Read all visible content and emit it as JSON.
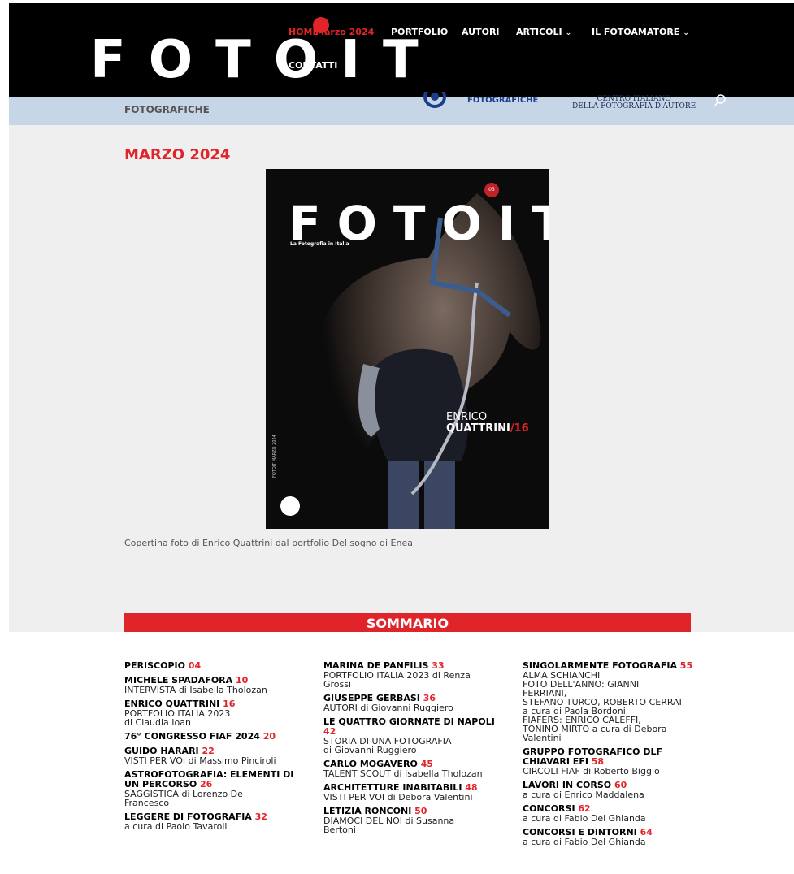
{
  "brand": {
    "logo_text": "FOTOIT"
  },
  "nav": {
    "items": [
      {
        "label": "HOME",
        "overlay": "Marzo 2024",
        "has_dropdown": false
      },
      {
        "label": "PORTFOLIO",
        "has_dropdown": false
      },
      {
        "label": "AUTORI",
        "has_dropdown": false
      },
      {
        "label": "ARTICOLI",
        "has_dropdown": true
      },
      {
        "label": "IL FOTOAMATORE",
        "has_dropdown": true
      },
      {
        "label": "CONTATTI",
        "has_dropdown": false
      }
    ]
  },
  "subheader": {
    "left_text": "FOTOGRAFICHE",
    "fiaf_text": "FOTOGRAFICHE",
    "cifa_line1": "CENTRO ITALIANO",
    "cifa_line2": "DELLA FOTOGRAFIA D'AUTORE"
  },
  "article": {
    "title": "MARZO 2024",
    "cover": {
      "logo": "FOTOIT",
      "subtitle": "La Fotografia in Italia",
      "issue": "03",
      "author_first": "ENRICO",
      "author_last": "QUATTRINI",
      "page_ref": "/16",
      "spine": "FOTOIT MARZO 2024"
    },
    "caption": "Copertina foto di Enrico Quattrini dal portfolio Del sogno di Enea"
  },
  "summary": {
    "heading": "SOMMARIO",
    "columns": [
      [
        {
          "title": "PERISCOPIO",
          "page": "04",
          "lines": []
        },
        {
          "title": "MICHELE SPADAFORA",
          "page": "10",
          "lines": [
            "INTERVISTA di Isabella Tholozan"
          ]
        },
        {
          "title": "ENRICO QUATTRINI",
          "page": "16",
          "lines": [
            "PORTFOLIO ITALIA 2023",
            "di Claudia Ioan"
          ]
        },
        {
          "title": "76° CONGRESSO FIAF 2024",
          "page": "20",
          "lines": []
        },
        {
          "title": "GUIDO HARARI",
          "page": "22",
          "lines": [
            "VISTI PER VOI di Massimo Pinciroli"
          ]
        },
        {
          "title": "ASTROFOTOGRAFIA: ELEMENTI DI UN PERCORSO",
          "page": "26",
          "lines": [
            "SAGGISTICA di Lorenzo De",
            "Francesco"
          ]
        },
        {
          "title": "LEGGERE DI FOTOGRAFIA",
          "page": "32",
          "lines": [
            "a cura di Paolo Tavaroli"
          ]
        }
      ],
      [
        {
          "title": "MARINA DE PANFILIS",
          "page": "33",
          "lines": [
            "PORTFOLIO ITALIA 2023 di Renza",
            "Grossi"
          ]
        },
        {
          "title": "GIUSEPPE GERBASI",
          "page": "36",
          "lines": [
            "AUTORI di Giovanni Ruggiero"
          ]
        },
        {
          "title": "LE QUATTRO GIORNATE DI NAPOLI",
          "page": "42",
          "lines": [
            "STORIA DI UNA FOTOGRAFIA",
            "di Giovanni Ruggiero"
          ]
        },
        {
          "title": "CARLO MOGAVERO",
          "page": "45",
          "lines": [
            "TALENT SCOUT di Isabella Tholozan"
          ]
        },
        {
          "title": "ARCHITETTURE INABITABILI",
          "page": "48",
          "lines": [
            "VISTI PER VOI di Debora Valentini"
          ]
        },
        {
          "title": "LETIZIA RONCONI",
          "page": "50",
          "lines": [
            "DIAMOCI DEL NOI di Susanna",
            "Bertoni"
          ]
        }
      ],
      [
        {
          "title": "SINGOLARMENTE FOTOGRAFIA",
          "page": "55",
          "lines": [
            "ALMA SCHIANCHI",
            "FOTO DELL'ANNO: GIANNI",
            "FERRIANI,",
            "STEFANO TURCO, ROBERTO CERRAI",
            "a cura di Paola Bordoni",
            "FIAFERS: ENRICO CALEFFI,",
            "TONINO MIRTO a cura di Debora",
            "Valentini"
          ]
        },
        {
          "title": "GRUPPO FOTOGRAFICO DLF CHIAVARI EFI",
          "page": "58",
          "lines": [
            "CIRCOLI FIAF di Roberto Biggio"
          ]
        },
        {
          "title": "LAVORI IN CORSO",
          "page": "60",
          "lines": [
            "a cura di Enrico Maddalena"
          ]
        },
        {
          "title": "CONCORSI",
          "page": "62",
          "lines": [
            "a cura di Fabio Del Ghianda"
          ]
        },
        {
          "title": "CONCORSI E DINTORNI",
          "page": "64",
          "lines": [
            "a cura di Fabio Del Ghianda"
          ]
        }
      ]
    ]
  },
  "colors": {
    "accent": "#e0252a",
    "topbar": "#000000",
    "band": "#c6d6e6"
  },
  "icons": {
    "search": "search-icon"
  }
}
